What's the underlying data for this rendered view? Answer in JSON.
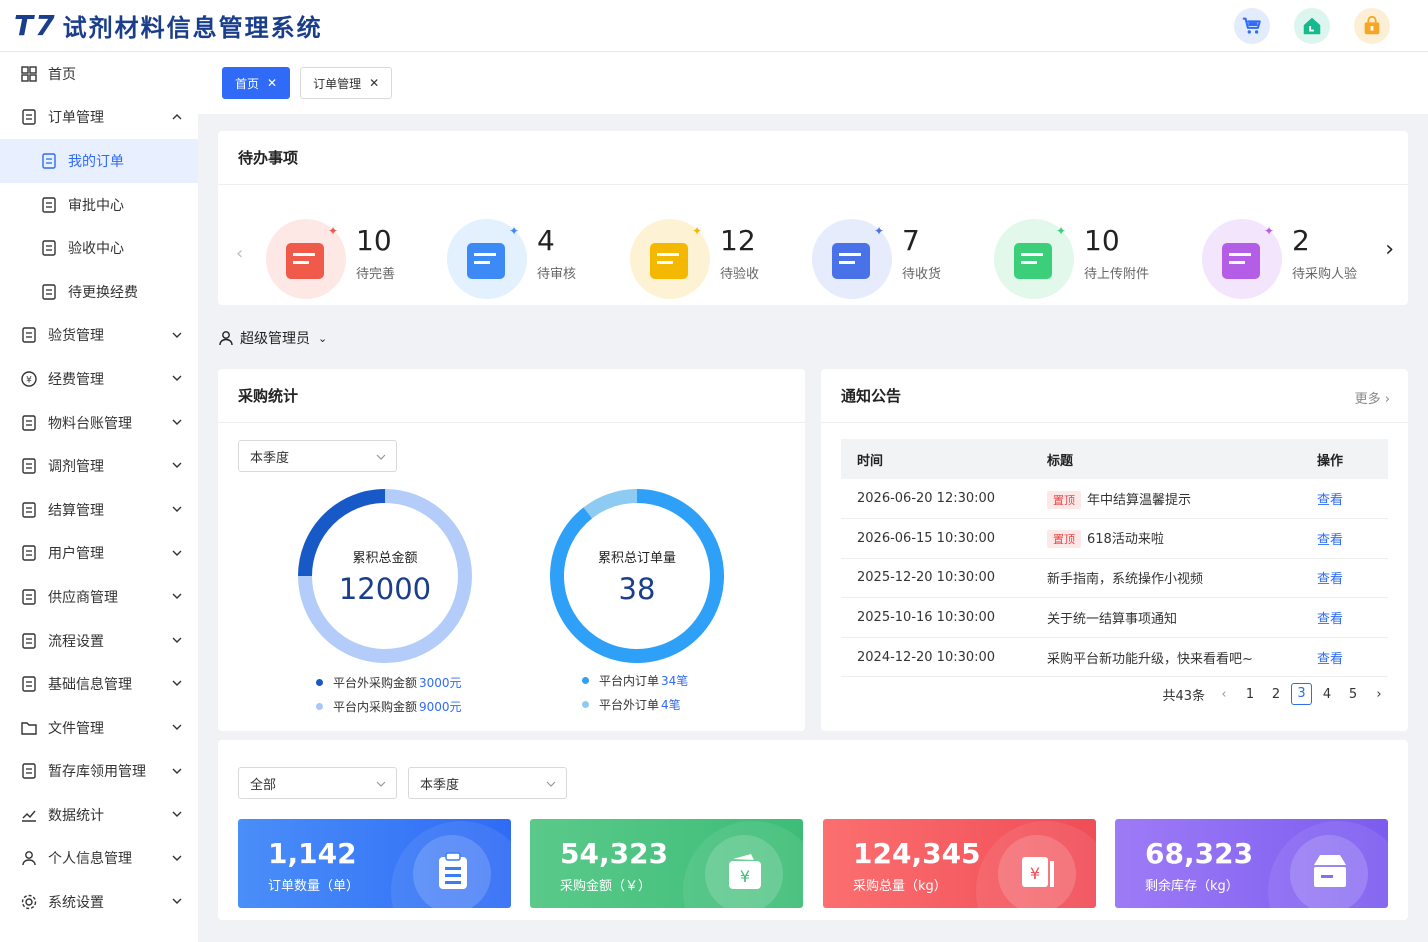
{
  "app": {
    "logo_mark": "T7",
    "title": "试剂材料信息管理系统"
  },
  "header_icons": [
    "cart-icon",
    "home-icon",
    "bag-icon"
  ],
  "sidebar": {
    "items": [
      {
        "label": "首页",
        "icon": "grid-icon"
      },
      {
        "label": "订单管理",
        "icon": "document-icon",
        "expanded": true
      },
      {
        "label": "我的订单",
        "icon": "order-icon",
        "sub": true,
        "active": true
      },
      {
        "label": "审批中心",
        "icon": "stamp-icon",
        "sub": true
      },
      {
        "label": "验收中心",
        "icon": "check-doc-icon",
        "sub": true
      },
      {
        "label": "待更换经费",
        "icon": "yen-exchange-icon",
        "sub": true
      },
      {
        "label": "验货管理",
        "icon": "inspect-icon"
      },
      {
        "label": "经费管理",
        "icon": "yen-icon"
      },
      {
        "label": "物料台账管理",
        "icon": "ledger-icon"
      },
      {
        "label": "调剂管理",
        "icon": "adjust-icon"
      },
      {
        "label": "结算管理",
        "icon": "settle-icon"
      },
      {
        "label": "用户管理",
        "icon": "users-icon"
      },
      {
        "label": "供应商管理",
        "icon": "supplier-icon"
      },
      {
        "label": "流程设置",
        "icon": "flow-icon"
      },
      {
        "label": "基础信息管理",
        "icon": "bank-icon"
      },
      {
        "label": "文件管理",
        "icon": "folder-icon"
      },
      {
        "label": "暂存库领用管理",
        "icon": "storage-icon"
      },
      {
        "label": "数据统计",
        "icon": "chart-icon"
      },
      {
        "label": "个人信息管理",
        "icon": "person-icon"
      },
      {
        "label": "系统设置",
        "icon": "gear-icon"
      }
    ]
  },
  "tabs": [
    {
      "label": "首页",
      "active": true
    },
    {
      "label": "订单管理",
      "active": false
    }
  ],
  "todo": {
    "title": "待办事项",
    "items": [
      {
        "num": "10",
        "label": "待完善",
        "color": "#ef5a4a",
        "bg": "#fde8e6"
      },
      {
        "num": "4",
        "label": "待审核",
        "color": "#3d8af7",
        "bg": "#e3f0fd"
      },
      {
        "num": "12",
        "label": "待验收",
        "color": "#f5b800",
        "bg": "#fdf3d4"
      },
      {
        "num": "7",
        "label": "待收货",
        "color": "#4a72e8",
        "bg": "#e6ecfc"
      },
      {
        "num": "10",
        "label": "待上传附件",
        "color": "#3ccf7a",
        "bg": "#e1f8ea"
      },
      {
        "num": "2",
        "label": "待采购人验",
        "color": "#b45ee8",
        "bg": "#f3e6fc"
      }
    ]
  },
  "role": {
    "label": "超级管理员"
  },
  "purchase": {
    "title": "采购统计",
    "period": "本季度",
    "amount": {
      "label": "累积总金额",
      "value": "12000",
      "legend": [
        {
          "label": "平台外采购金额",
          "value": "3000元",
          "color": "#1659c7"
        },
        {
          "label": "平台内采购金额",
          "value": "9000元",
          "color": "#a9c8f8"
        }
      ]
    },
    "orders": {
      "label": "累积总订单量",
      "value": "38",
      "legend": [
        {
          "label": "平台内订单",
          "value": "34笔",
          "color": "#2ea0f8"
        },
        {
          "label": "平台外订单",
          "value": "4笔",
          "color": "#8ecbf2"
        }
      ]
    }
  },
  "chart_data": [
    {
      "type": "pie",
      "title": "累积总金额",
      "center_value": "12000",
      "categories": [
        "平台外采购金额",
        "平台内采购金额"
      ],
      "values": [
        3000,
        9000
      ],
      "colors": [
        "#1659c7",
        "#b3ccf9"
      ]
    },
    {
      "type": "pie",
      "title": "累积总订单量",
      "center_value": "38",
      "categories": [
        "平台内订单",
        "平台外订单"
      ],
      "values": [
        34,
        4
      ],
      "colors": [
        "#2ea0f8",
        "#8ecbf2"
      ]
    }
  ],
  "notice": {
    "title": "通知公告",
    "more": "更多",
    "columns": [
      "时间",
      "标题",
      "操作"
    ],
    "rows": [
      {
        "time": "2026-06-20 12:30:00",
        "tag": "置顶",
        "title": "年中结算温馨提示",
        "action": "查看"
      },
      {
        "time": "2026-06-15 10:30:00",
        "tag": "置顶",
        "title": "618活动来啦",
        "action": "查看"
      },
      {
        "time": "2025-12-20 10:30:00",
        "tag": "",
        "title": "新手指南，系统操作小视频",
        "action": "查看"
      },
      {
        "time": "2025-10-16 10:30:00",
        "tag": "",
        "title": "关于统一结算事项通知",
        "action": "查看"
      },
      {
        "time": "2024-12-20 10:30:00",
        "tag": "",
        "title": "采购平台新功能升级，快来看看吧~",
        "action": "查看"
      }
    ],
    "pager": {
      "total": "共43条",
      "pages": [
        "1",
        "2",
        "3",
        "4",
        "5"
      ],
      "current": "3"
    }
  },
  "stats": {
    "filter_all": "全部",
    "filter_period": "本季度",
    "cards": [
      {
        "value": "1,142",
        "label": "订单数量（单）",
        "icon": "clipboard-icon"
      },
      {
        "value": "54,323",
        "label": "采购金额（￥）",
        "icon": "wallet-icon"
      },
      {
        "value": "124,345",
        "label": "采购总量（kg）",
        "icon": "invoice-icon"
      },
      {
        "value": "68,323",
        "label": "剩余库存（kg）",
        "icon": "box-icon"
      }
    ]
  }
}
